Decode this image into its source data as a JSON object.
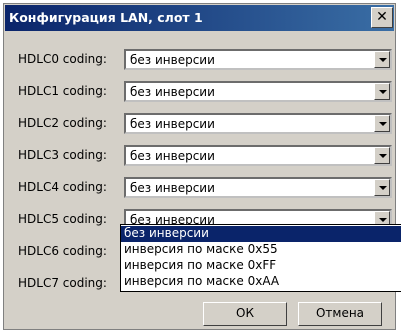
{
  "window": {
    "title": "Конфигурация LAN, слот 1",
    "close_icon": "close-icon"
  },
  "rows": [
    {
      "label": "HDLC0 coding:",
      "value": "без инверсии"
    },
    {
      "label": "HDLC1 coding:",
      "value": "без инверсии"
    },
    {
      "label": "HDLC2 coding:",
      "value": "без инверсии"
    },
    {
      "label": "HDLC3 coding:",
      "value": "без инверсии"
    },
    {
      "label": "HDLC4 coding:",
      "value": "без инверсии"
    },
    {
      "label": "HDLC5 coding:",
      "value": "без инверсии"
    },
    {
      "label": "HDLC6 coding:",
      "value": ""
    },
    {
      "label": "HDLC7 coding:",
      "value": ""
    }
  ],
  "dropdown": {
    "options": [
      "без инверсии",
      "инверсия по маске 0x55",
      "инверсия по маске 0xFF",
      "инверсия по маске 0xAA"
    ],
    "selected_index": 0
  },
  "buttons": {
    "ok": "ОК",
    "cancel": "Отмена"
  },
  "colors": {
    "title_bar": "#0a246a",
    "dialog_bg": "#d4d0c8",
    "selection": "#0a246a"
  }
}
